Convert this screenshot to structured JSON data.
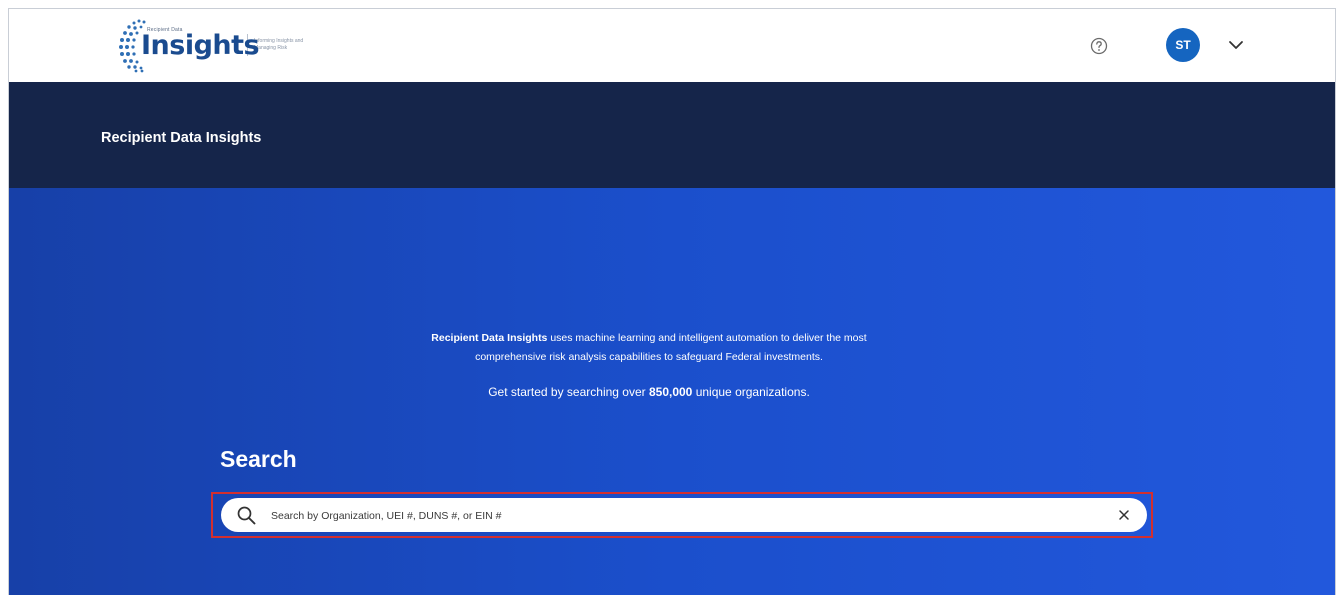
{
  "header": {
    "logo": {
      "wordmark": "Insights",
      "small_text": "Recipient Data",
      "tagline": "Informing Insights and Managing Risk"
    },
    "help_icon": "help-circle-icon",
    "user_initials": "ST",
    "menu_icon": "chevron-down-icon"
  },
  "banner": {
    "title": "Recipient Data Insights"
  },
  "hero": {
    "intro_bold": "Recipient Data Insights",
    "intro_rest_line1": " uses machine learning and intelligent automation to deliver the most",
    "intro_line2": "comprehensive risk analysis capabilities to safeguard Federal investments.",
    "count_prefix": "Get started by searching over ",
    "count_value": "850,000",
    "count_suffix": " unique organizations."
  },
  "search": {
    "heading": "Search",
    "placeholder": "Search by Organization, UEI #, DUNS #, or EIN #",
    "value": ""
  },
  "colors": {
    "header_bg": "#ffffff",
    "dark_banner": "#15254a",
    "hero_blue": "#1b4fcc",
    "avatar_blue": "#1565c0",
    "highlight_red": "#d32f2f"
  }
}
